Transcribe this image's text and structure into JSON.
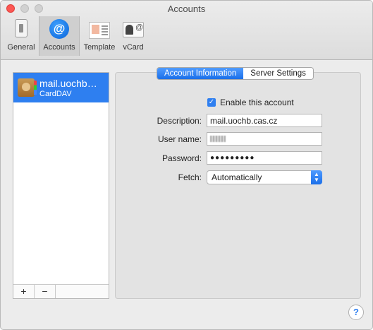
{
  "window": {
    "title": "Accounts"
  },
  "toolbar": {
    "items": [
      {
        "label": "General",
        "icon": "general-switch-icon"
      },
      {
        "label": "Accounts",
        "icon": "at-sign-icon",
        "active": true
      },
      {
        "label": "Template",
        "icon": "template-icon"
      },
      {
        "label": "vCard",
        "icon": "vcard-icon"
      }
    ]
  },
  "sidebar": {
    "accounts": [
      {
        "name": "mail.uochb.cas.cz",
        "name_display": "mail.uochb…",
        "type": "CardDAV",
        "selected": true
      }
    ],
    "add_label": "+",
    "remove_label": "−"
  },
  "tabs": {
    "items": [
      {
        "label": "Account Information",
        "active": true
      },
      {
        "label": "Server Settings",
        "active": false
      }
    ]
  },
  "form": {
    "enable_label": "Enable this account",
    "enable_checked": true,
    "description_label": "Description:",
    "description_value": "mail.uochb.cas.cz",
    "username_label": "User name:",
    "password_label": "Password:",
    "password_mask": "●●●●●●●●●",
    "fetch_label": "Fetch:",
    "fetch_value": "Automatically"
  },
  "help": {
    "label": "?"
  },
  "colors": {
    "accent": "#2e7ff0",
    "close": "#fc5753"
  }
}
